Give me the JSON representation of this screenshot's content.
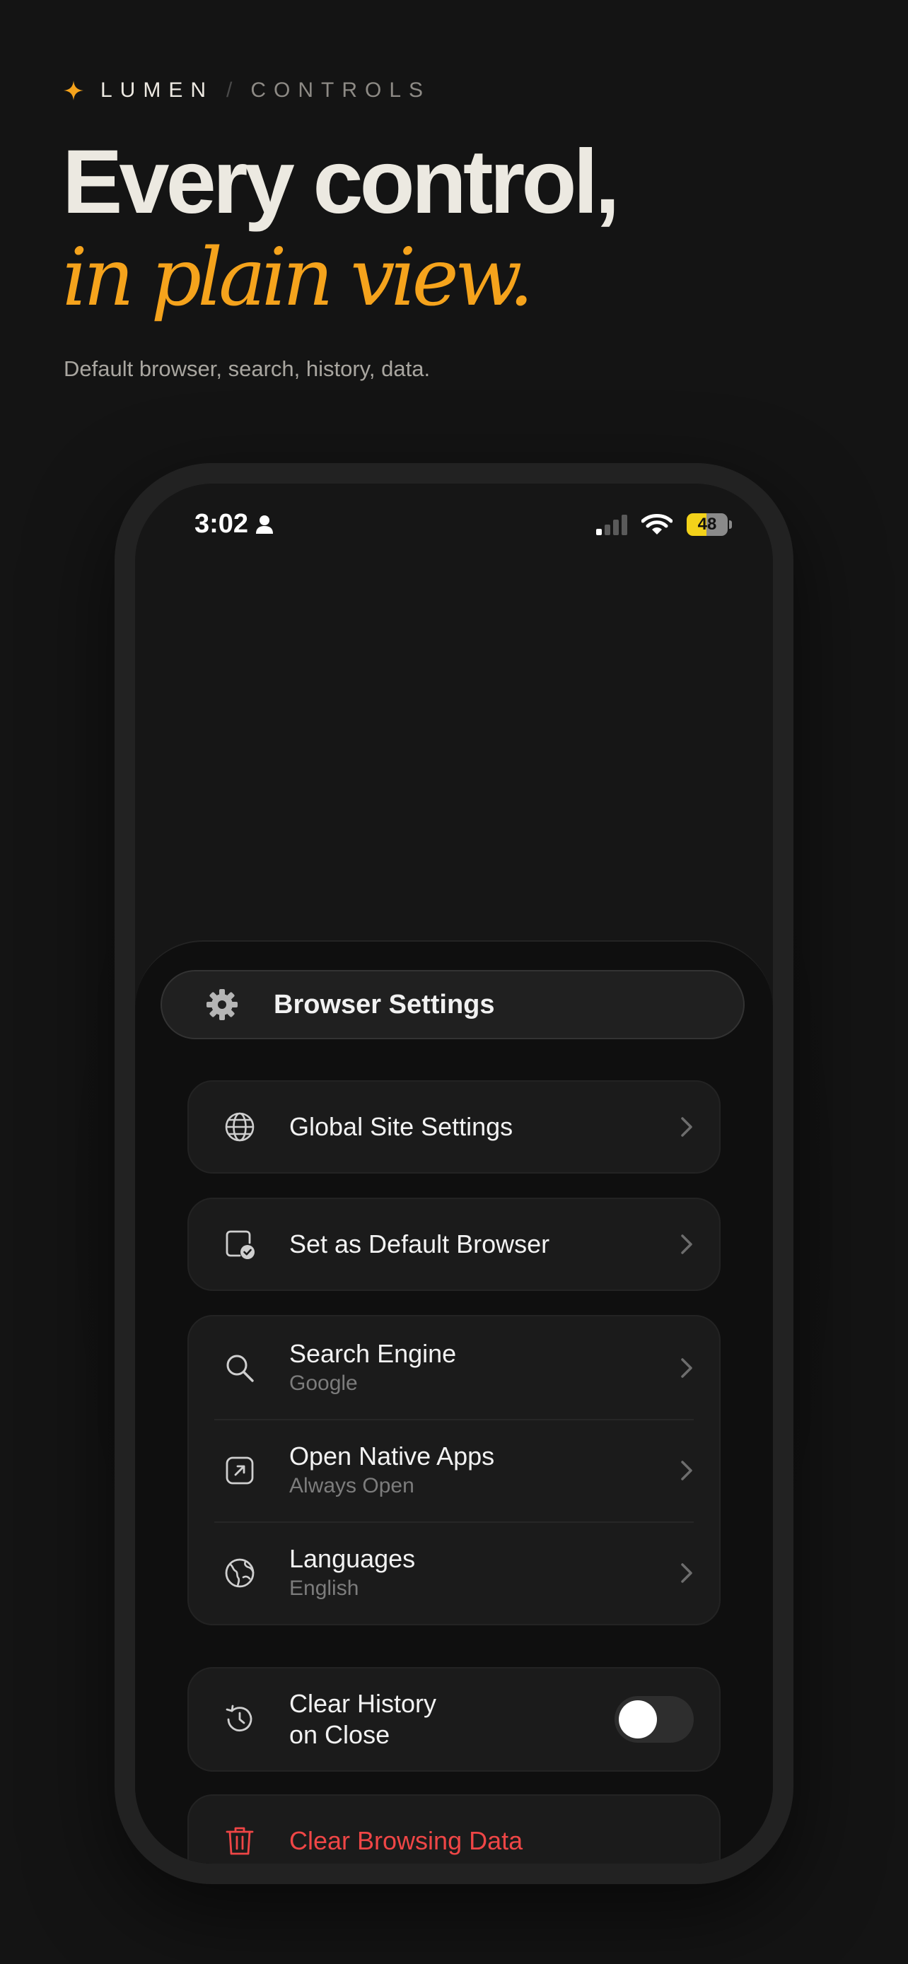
{
  "brand": {
    "name": "LUMEN",
    "separator": "/",
    "section": "CONTROLS",
    "accent_color": "#f5a31c"
  },
  "hero": {
    "headline_line1": "Every control,",
    "headline_line2": "in plain view.",
    "subheadline": "Default browser, search, history, data."
  },
  "status_bar": {
    "time": "3:02",
    "battery_level": "48",
    "icons": [
      "person-icon",
      "signal-icon",
      "wifi-icon",
      "battery-icon"
    ]
  },
  "sheet": {
    "title": "Browser Settings",
    "title_icon": "gear-icon",
    "items": {
      "global_site_settings": {
        "label": "Global Site Settings",
        "icon": "globe-icon"
      },
      "default_browser": {
        "label": "Set as Default Browser",
        "icon": "default-browser-icon"
      },
      "search_engine": {
        "label": "Search Engine",
        "value": "Google",
        "icon": "search-icon"
      },
      "open_native_apps": {
        "label": "Open Native Apps",
        "value": "Always Open",
        "icon": "external-link-icon"
      },
      "languages": {
        "label": "Languages",
        "value": "English",
        "icon": "language-globe-icon"
      },
      "clear_history": {
        "label_line1": "Clear History",
        "label_line2": "on Close",
        "icon": "history-icon",
        "enabled": false
      },
      "clear_browsing_data": {
        "label": "Clear Browsing Data",
        "icon": "trash-icon",
        "color": "#ef4646"
      }
    }
  }
}
